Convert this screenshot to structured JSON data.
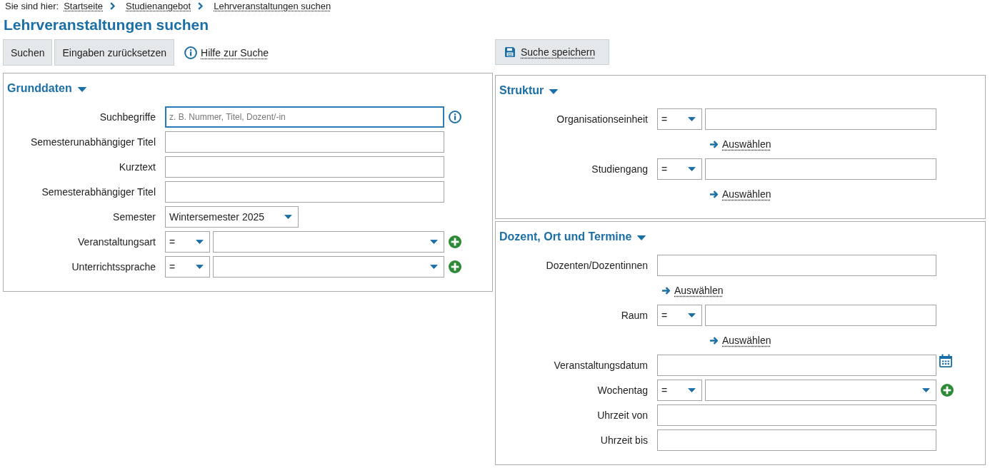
{
  "breadcrumb": {
    "label": "Sie sind hier:",
    "links": [
      "Startseite",
      "Studienangebot",
      "Lehrveranstaltungen suchen"
    ]
  },
  "title": "Lehrveranstaltungen suchen",
  "toolbar": {
    "buttons": [
      "Suchen",
      "Eingaben zurücksetzen"
    ],
    "help_link": "Hilfe zur Suche",
    "save_button": "Suche speichern"
  },
  "columns": [
    {
      "panels": [
        {
          "title": "Grunddaten",
          "expanded": true,
          "fields": [
            {
              "kind": "text",
              "label": "Suchbegriffe",
              "placeholder": "z. B. Nummer, Titel, Dozent/-in",
              "focused": true,
              "action": {
                "kind": "info"
              }
            },
            {
              "kind": "text",
              "label": "Semesterunabhängiger Titel",
              "focused": false
            },
            {
              "kind": "text",
              "label": "Kurztext",
              "focused": false
            },
            {
              "kind": "text",
              "label": "Semesterabhängiger Titel",
              "focused": false
            },
            {
              "kind": "select",
              "label": "Semester",
              "value": "Wintersemester 2025",
              "focused": false
            },
            {
              "kind": "select",
              "label": "Veranstaltungsart",
              "operator": "=",
              "focused": false,
              "action": {
                "kind": "add"
              }
            },
            {
              "kind": "select",
              "label": "Unterrichtssprache",
              "operator": "=",
              "focused": false,
              "action": {
                "kind": "add"
              }
            }
          ]
        }
      ]
    },
    {
      "panels": [
        {
          "title": "Struktur",
          "expanded": true,
          "fields": [
            {
              "kind": "text",
              "label": "Organisationseinheit",
              "operator": "=",
              "focused": false,
              "link": "Auswählen"
            },
            {
              "kind": "text",
              "label": "Studiengang",
              "operator": "=",
              "focused": false,
              "link": "Auswählen"
            }
          ]
        },
        {
          "title": "Dozent, Ort und Termine",
          "expanded": true,
          "fields": [
            {
              "kind": "text",
              "label": "Dozenten/Dozentinnen",
              "focused": false,
              "link": "Auswählen"
            },
            {
              "kind": "text",
              "label": "Raum",
              "operator": "=",
              "focused": false,
              "link": "Auswählen"
            },
            {
              "kind": "text",
              "label": "Veranstaltungsdatum",
              "focused": false,
              "action": {
                "kind": "calendar"
              }
            },
            {
              "kind": "select",
              "label": "Wochentag",
              "operator": "=",
              "focused": false,
              "action": {
                "kind": "add"
              }
            },
            {
              "kind": "text",
              "label": "Uhrzeit von",
              "focused": false
            },
            {
              "kind": "text",
              "label": "Uhrzeit bis",
              "focused": false
            }
          ]
        }
      ]
    }
  ]
}
